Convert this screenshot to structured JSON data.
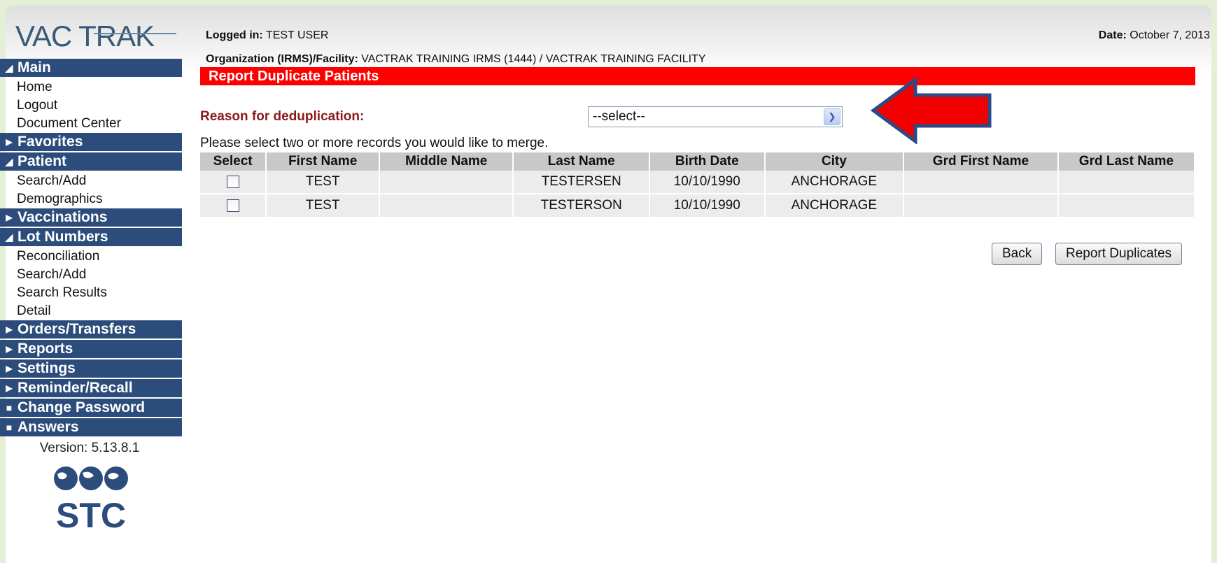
{
  "logo_text": "VAC TRAK",
  "header": {
    "logged_in_label": "Logged in:",
    "logged_in_value": "TEST USER",
    "date_label": "Date:",
    "date_value": "October 7, 2013",
    "org_label": "Organization (IRMS)/Facility:",
    "org_value": "VACTRAK TRAINING IRMS (1444) / VACTRAK TRAINING FACILITY"
  },
  "sidebar": {
    "sections": [
      {
        "label": "Main",
        "state": "expanded",
        "items": [
          "Home",
          "Logout",
          "Document Center"
        ]
      },
      {
        "label": "Favorites",
        "state": "collapsed",
        "items": []
      },
      {
        "label": "Patient",
        "state": "expanded",
        "items": [
          "Search/Add",
          "Demographics"
        ]
      },
      {
        "label": "Vaccinations",
        "state": "collapsed",
        "items": []
      },
      {
        "label": "Lot Numbers",
        "state": "expanded",
        "items": [
          "Reconciliation",
          "Search/Add",
          "Search Results",
          "Detail"
        ]
      },
      {
        "label": "Orders/Transfers",
        "state": "collapsed",
        "items": []
      },
      {
        "label": "Reports",
        "state": "collapsed",
        "items": []
      },
      {
        "label": "Settings",
        "state": "collapsed",
        "items": []
      },
      {
        "label": "Reminder/Recall",
        "state": "collapsed",
        "items": []
      },
      {
        "label": "Change Password",
        "state": "leaf",
        "items": []
      },
      {
        "label": "Answers",
        "state": "leaf",
        "items": []
      }
    ],
    "version": "Version: 5.13.8.1",
    "vendor_logo_text": "STC"
  },
  "page": {
    "title": "Report Duplicate Patients",
    "reason_label": "Reason for deduplication:",
    "reason_select_value": "--select--",
    "hint": "Please select two or more records you would like to merge.",
    "columns": [
      "Select",
      "First Name",
      "Middle Name",
      "Last Name",
      "Birth Date",
      "City",
      "Grd First Name",
      "Grd Last Name"
    ],
    "rows": [
      {
        "first": "TEST",
        "middle": "",
        "last": "TESTERSEN",
        "birth": "10/10/1990",
        "city": "ANCHORAGE",
        "grd_first": "",
        "grd_last": ""
      },
      {
        "first": "TEST",
        "middle": "",
        "last": "TESTERSON",
        "birth": "10/10/1990",
        "city": "ANCHORAGE",
        "grd_first": "",
        "grd_last": ""
      }
    ],
    "back_label": "Back",
    "report_label": "Report Duplicates"
  },
  "colors": {
    "nav_header": "#2c4c7c",
    "title_bar": "#ff0000",
    "label_red": "#8b1a1a",
    "page_border": "#e4efd6"
  }
}
